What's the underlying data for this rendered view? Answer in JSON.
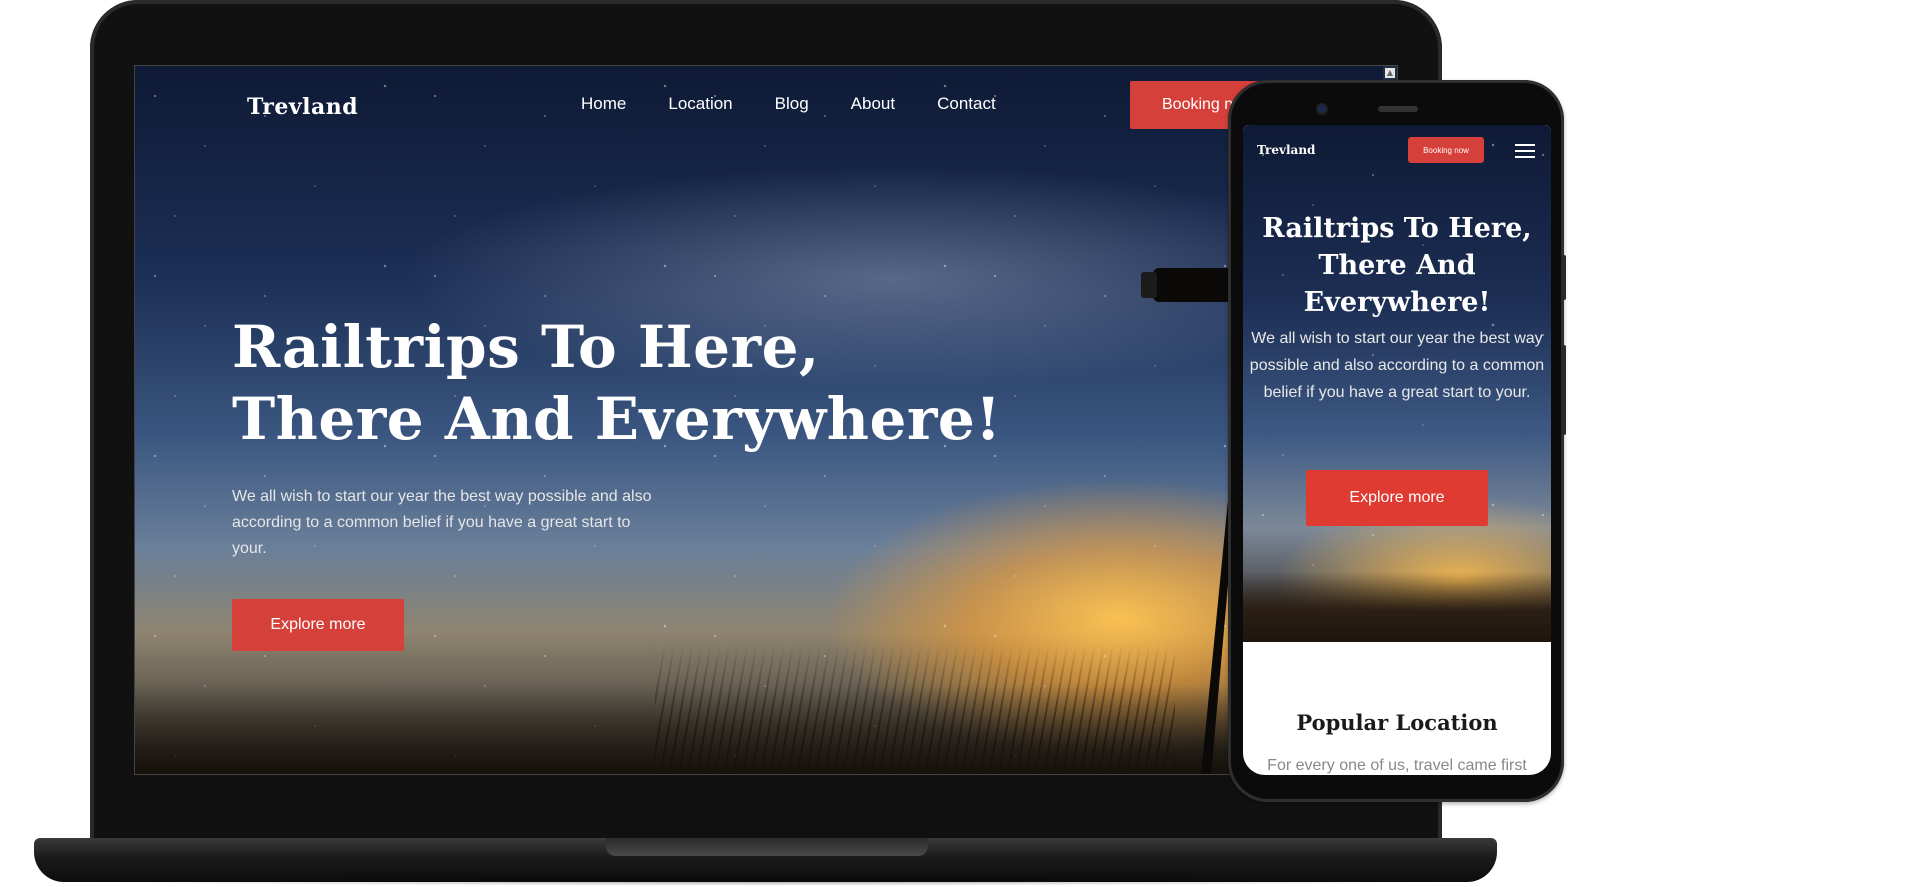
{
  "site": {
    "logo": "Trevland",
    "nav": [
      "Home",
      "Location",
      "Blog",
      "About",
      "Contact"
    ],
    "booking_label": "Booking now"
  },
  "hero": {
    "title_line1": "Railtrips To Here,",
    "title_line2": "There And Everywhere!",
    "description": "We all wish to start our year the best way possible and also according to a common belief if you have a great start to your.",
    "button_label": "Explore more"
  },
  "mobile": {
    "logo": "Trevland",
    "booking_label": "Booking now",
    "title_line1": "Railtrips To Here,",
    "title_line2": "There And",
    "title_line3": "Everywhere!",
    "description": "We all wish to start our year the best way possible and also according to a common belief if you have a great start to your.",
    "button_label": "Explore more",
    "section_title": "Popular Location",
    "section_text": "For every one of us, travel came first"
  },
  "icons": {
    "menu": "hamburger-menu-icon",
    "scroll": "scroll-up-arrow-icon"
  },
  "colors": {
    "accent": "#d6403a",
    "night_sky": "#0e1a35",
    "sunset": "#ffc450"
  }
}
